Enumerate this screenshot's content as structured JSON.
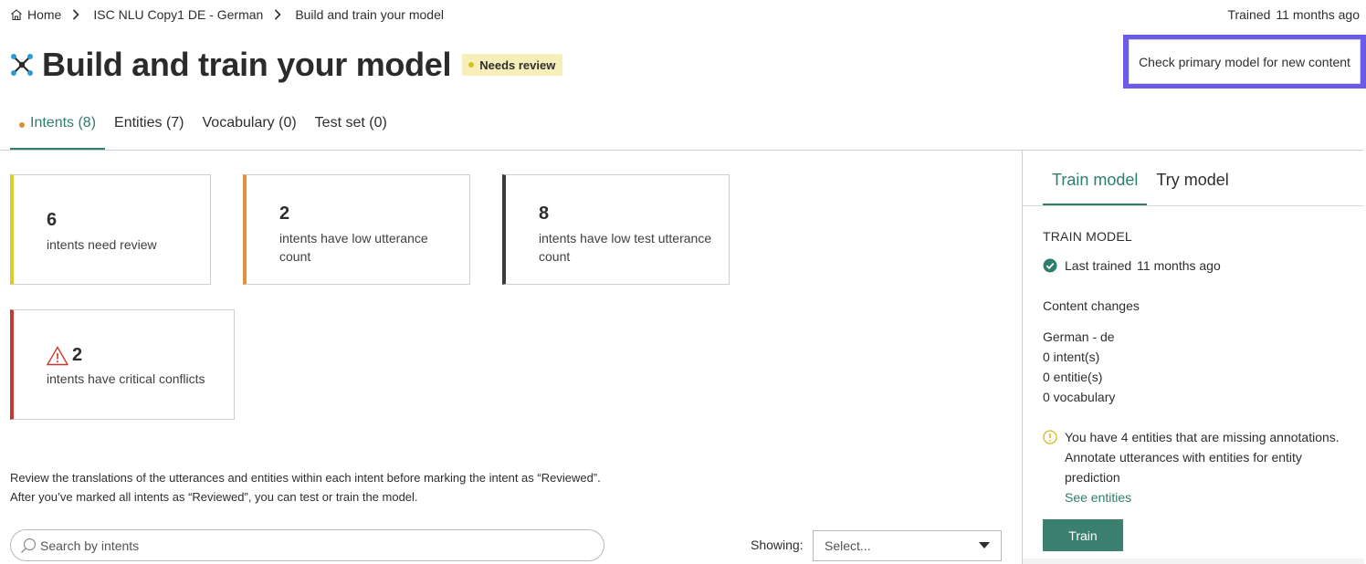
{
  "breadcrumb": {
    "home": "Home",
    "project": "ISC NLU Copy1 DE - German",
    "current": "Build and train your model"
  },
  "trained_status": {
    "label": "Trained",
    "value": "11 months ago"
  },
  "header": {
    "title": "Build and train your model",
    "badge": "Needs review",
    "check_button": "Check primary model for new content",
    "icon": "network-model-icon"
  },
  "tabs": [
    {
      "label": "Intents (8)",
      "active": true
    },
    {
      "label": "Entities (7)",
      "active": false
    },
    {
      "label": "Vocabulary (0)",
      "active": false
    },
    {
      "label": "Test set (0)",
      "active": false
    }
  ],
  "cards": [
    {
      "count": "6",
      "text": "intents need review",
      "color": "#dccb30"
    },
    {
      "count": "2",
      "text": "intents have low utterance count",
      "color": "#e0913a"
    },
    {
      "count": "8",
      "text": "intents have low test utterance count",
      "color": "#3c3c3c"
    },
    {
      "count": "2",
      "text": "intents have critical conflicts",
      "color": "#c9382e",
      "icon": "warning-icon"
    }
  ],
  "review_text": {
    "line1": "Review the translations of the utterances and entities within each intent before marking the intent as “Reviewed”.",
    "line2": "After you’ve marked all intents as “Reviewed”, you can test or train the model."
  },
  "search": {
    "placeholder": "Search by intents"
  },
  "filter": {
    "label": "Showing:",
    "value": "Select..."
  },
  "right_panel": {
    "tabs": [
      {
        "label": "Train model",
        "active": true
      },
      {
        "label": "Try model",
        "active": false
      }
    ],
    "heading": "TRAIN MODEL",
    "last_trained_label": "Last trained",
    "last_trained_value": "11 months ago",
    "content_changes_title": "Content changes",
    "content_changes": [
      "German - de",
      "0 intent(s)",
      "0 entitie(s)",
      "0 vocabulary"
    ],
    "notice": "You have 4 entities that are missing annotations. Annotate utterances with entities for entity prediction",
    "notice_link": "See entities",
    "train_button": "Train"
  },
  "colors": {
    "accent": "#2e7d6d",
    "focus_frame": "#6b5ce7",
    "badge_bg": "#f6efb9"
  }
}
